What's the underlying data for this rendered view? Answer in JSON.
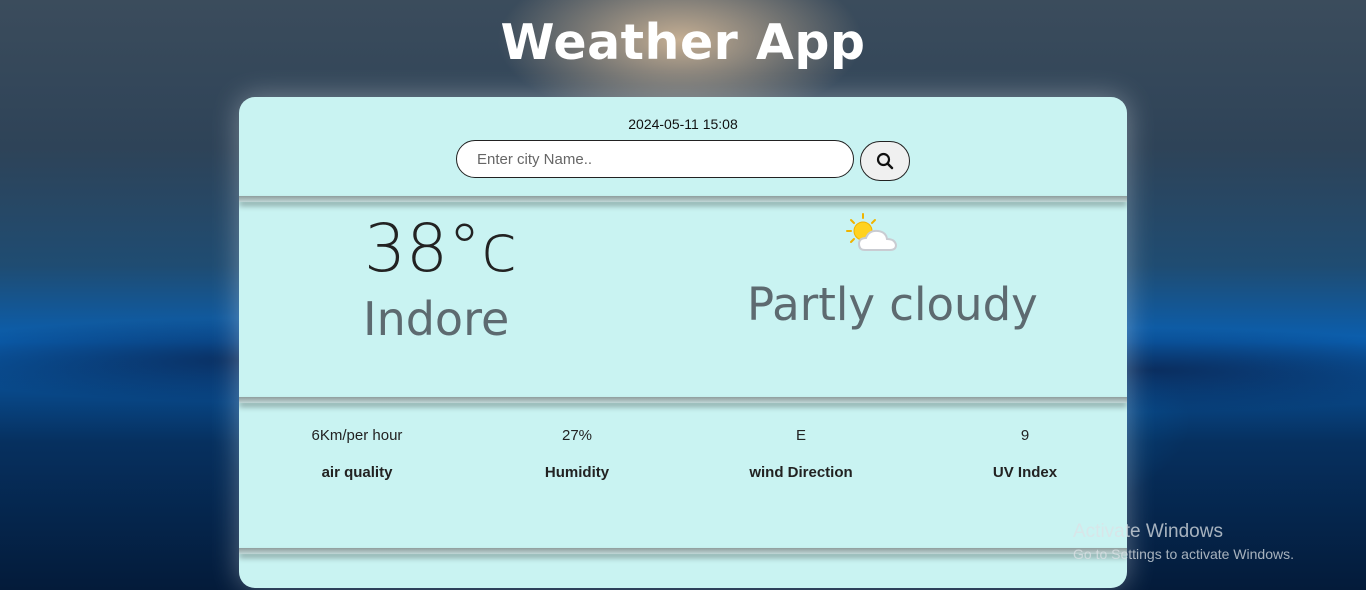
{
  "app": {
    "title": "Weather App"
  },
  "header": {
    "datetime": "2024-05-11 15:08"
  },
  "search": {
    "placeholder": "Enter city Name..",
    "value": "",
    "icon": "search-icon"
  },
  "current": {
    "temperature": "38°c",
    "city": "Indore",
    "condition": "Partly cloudy",
    "icon": "partly-cloudy-icon"
  },
  "stats": [
    {
      "value": "6Km/per hour",
      "label": "air quality"
    },
    {
      "value": "27%",
      "label": "Humidity"
    },
    {
      "value": "E",
      "label": "wind Direction"
    },
    {
      "value": "9",
      "label": "UV Index"
    }
  ],
  "watermark": {
    "line1": "Activate Windows",
    "line2": "Go to Settings to activate Windows."
  },
  "colors": {
    "card": "#c9f3f2",
    "title": "#ffffff",
    "muted_text": "#5d6a70"
  }
}
